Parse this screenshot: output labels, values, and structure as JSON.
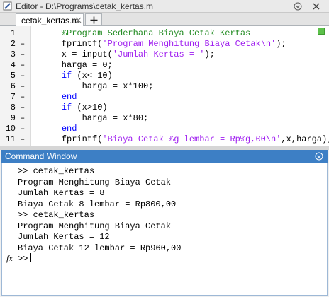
{
  "editor": {
    "title": "Editor - D:\\Programs\\cetak_kertas.m",
    "tab_label": "cetak_kertas.m",
    "status_color": "#5cc14a"
  },
  "code_lines": [
    {
      "n": "1",
      "dash": "",
      "parts": [
        {
          "t": "    ",
          "c": "nm"
        },
        {
          "t": "%Program Sederhana Biaya Cetak Kertas",
          "c": "cm"
        }
      ]
    },
    {
      "n": "2",
      "dash": "–",
      "parts": [
        {
          "t": "    fprintf(",
          "c": "nm"
        },
        {
          "t": "'Program Menghitung Biaya Cetak\\n'",
          "c": "str"
        },
        {
          "t": ");",
          "c": "nm"
        }
      ]
    },
    {
      "n": "3",
      "dash": "–",
      "parts": [
        {
          "t": "    x = input(",
          "c": "nm"
        },
        {
          "t": "'Jumlah Kertas = '",
          "c": "str"
        },
        {
          "t": ");",
          "c": "nm"
        }
      ]
    },
    {
      "n": "4",
      "dash": "–",
      "parts": [
        {
          "t": "    harga = 0;",
          "c": "nm"
        }
      ]
    },
    {
      "n": "5",
      "dash": "–",
      "parts": [
        {
          "t": "    ",
          "c": "nm"
        },
        {
          "t": "if",
          "c": "kw"
        },
        {
          "t": " (x<=10)",
          "c": "nm"
        }
      ]
    },
    {
      "n": "6",
      "dash": "–",
      "parts": [
        {
          "t": "        harga = x*100;",
          "c": "nm"
        }
      ]
    },
    {
      "n": "7",
      "dash": "–",
      "parts": [
        {
          "t": "    ",
          "c": "nm"
        },
        {
          "t": "end",
          "c": "kw"
        }
      ]
    },
    {
      "n": "8",
      "dash": "–",
      "parts": [
        {
          "t": "    ",
          "c": "nm"
        },
        {
          "t": "if",
          "c": "kw"
        },
        {
          "t": " (x>10)",
          "c": "nm"
        }
      ]
    },
    {
      "n": "9",
      "dash": "–",
      "parts": [
        {
          "t": "        harga = x*80;",
          "c": "nm"
        }
      ]
    },
    {
      "n": "10",
      "dash": "–",
      "parts": [
        {
          "t": "    ",
          "c": "nm"
        },
        {
          "t": "end",
          "c": "kw"
        }
      ]
    },
    {
      "n": "11",
      "dash": "–",
      "parts": [
        {
          "t": "    fprintf(",
          "c": "nm"
        },
        {
          "t": "'Biaya Cetak %g lembar = Rp%g,00\\n'",
          "c": "str"
        },
        {
          "t": ",x,harga);",
          "c": "nm"
        }
      ]
    }
  ],
  "command_window": {
    "title": "Command Window",
    "lines": [
      ">> cetak_kertas",
      "Program Menghitung Biaya Cetak",
      "Jumlah Kertas = 8",
      "Biaya Cetak 8 lembar = Rp800,00",
      ">> cetak_kertas",
      "Program Menghitung Biaya Cetak",
      "Jumlah Kertas = 12",
      "Biaya Cetak 12 lembar = Rp960,00"
    ],
    "prompt": ">>",
    "fx_label": "fx"
  },
  "icons": {
    "title": "pencil-icon",
    "menu": "chevron-down-circle-icon",
    "close": "close-icon",
    "tab_close": "tab-close-icon",
    "add_tab": "plus-icon"
  }
}
